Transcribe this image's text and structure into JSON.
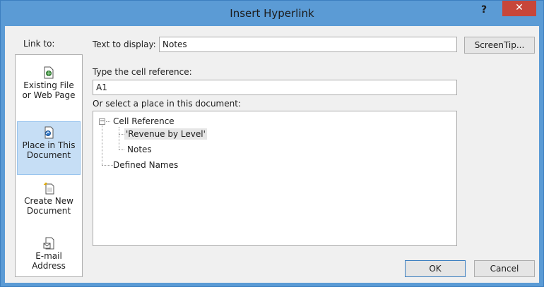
{
  "window": {
    "title": "Insert Hyperlink",
    "help_label": "?",
    "close_label": "✕"
  },
  "link_to": {
    "label": "Link to:",
    "items": [
      {
        "label": "Existing File\nor Web Page",
        "icon": "existing-file-icon",
        "selected": false
      },
      {
        "label": "Place in This\nDocument",
        "icon": "place-in-document-icon",
        "selected": true
      },
      {
        "label": "Create New\nDocument",
        "icon": "create-new-document-icon",
        "selected": false
      },
      {
        "label": "E-mail\nAddress",
        "icon": "email-address-icon",
        "selected": false
      }
    ]
  },
  "text_to_display": {
    "label": "Text to display:",
    "value": "Notes"
  },
  "screentip_label": "ScreenTip...",
  "cell_reference": {
    "label": "Type the cell reference:",
    "value": "A1"
  },
  "place_in_document": {
    "label": "Or select a place in this document:",
    "tree": {
      "root": "Cell Reference",
      "children": [
        "'Revenue by Level'",
        "Notes"
      ],
      "second_root": "Defined Names",
      "selected": "'Revenue by Level'"
    }
  },
  "buttons": {
    "ok": "OK",
    "cancel": "Cancel"
  },
  "colors": {
    "title_bar": "#5b9bd5",
    "close": "#c7463a",
    "selected_item": "#c6def5"
  }
}
